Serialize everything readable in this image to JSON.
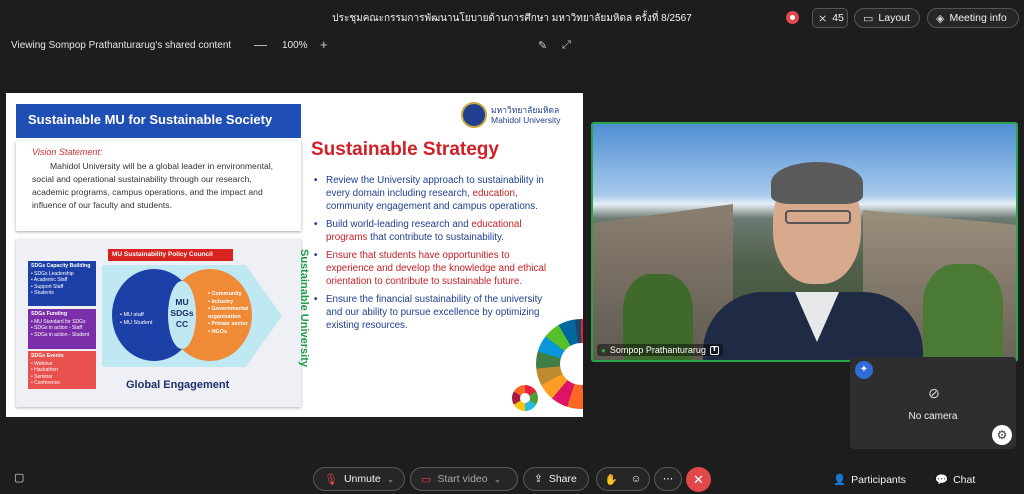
{
  "topbar": {
    "meeting_title": "ประชุมคณะกรรมการพัฒนานโยบายด้านการศึกษา มหาวิทยาลัยมหิดล ครั้งที่ 8/2567",
    "participant_count": "45",
    "layout_label": "Layout",
    "meeting_info_label": "Meeting info"
  },
  "sharebar": {
    "viewing_label": "Viewing Sompop Prathanturarug's shared content",
    "zoom_minus": "—",
    "zoom_level": "100%",
    "zoom_plus": "+"
  },
  "slide": {
    "header": "Sustainable MU for Sustainable Society",
    "logo_thai": "มหาวิทยาลัยมหิดล",
    "logo_en": "Mahidol University",
    "vision_title": "Vision Statement:",
    "vision_text": "Mahidol University will be a global leader in environmental, social and operational sustainability through our research, academic programs, campus operations, and the impact and influence of our faculty and students.",
    "strategy_title": "Sustainable Strategy",
    "bullets": {
      "b1_pre": "Review the University approach to sustainability in every domain including research, ",
      "b1_hl": "education",
      "b1_post": ", community engagement and campus operations.",
      "b2_pre": "Build world-leading research and ",
      "b2_hl": "educational programs",
      "b2_post": " that contribute to sustainability.",
      "b3": "Ensure that students have opportunities to experience and develop the knowledge and ethical orientation to contribute to sustainable future.",
      "b4": "Ensure the financial sustainability of the university and our ability to pursue excellence by optimizing existing resources."
    },
    "diagram": {
      "box1_title": "SDGs Capacity Building",
      "box1_items": [
        "• SDGs Leadership",
        "• Academic Staff",
        "• Support Staff",
        "• Students"
      ],
      "box2_title": "SDGs Funding",
      "box2_items": [
        "• MU Standard for SDGs",
        "• SDGs in action - Staff",
        "• SDGs in action - Student"
      ],
      "box3_title": "SDGs Events",
      "box3_items": [
        "• Webinar",
        "• Hackathon",
        "• Seminar",
        "• Conference"
      ],
      "council": "MU Sustainability Policy Council",
      "center_l1": "MU",
      "center_l2": "SDGs",
      "center_l3": "CC",
      "left_items": [
        "• MU staff",
        "• MU Student"
      ],
      "right_items": [
        "• Community",
        "• Industry",
        "• Governmental",
        "  organization",
        "• Private sector",
        "• NGOs"
      ],
      "global": "Global Engagement",
      "vertical": "Sustainable University"
    }
  },
  "video": {
    "speaker_name": "Sompop Prathanturarug",
    "no_camera": "No camera"
  },
  "bottombar": {
    "unmute_label": "Unmute",
    "video_label": "Start video",
    "share_label": "Share",
    "participants_label": "Participants",
    "chat_label": "Chat"
  }
}
